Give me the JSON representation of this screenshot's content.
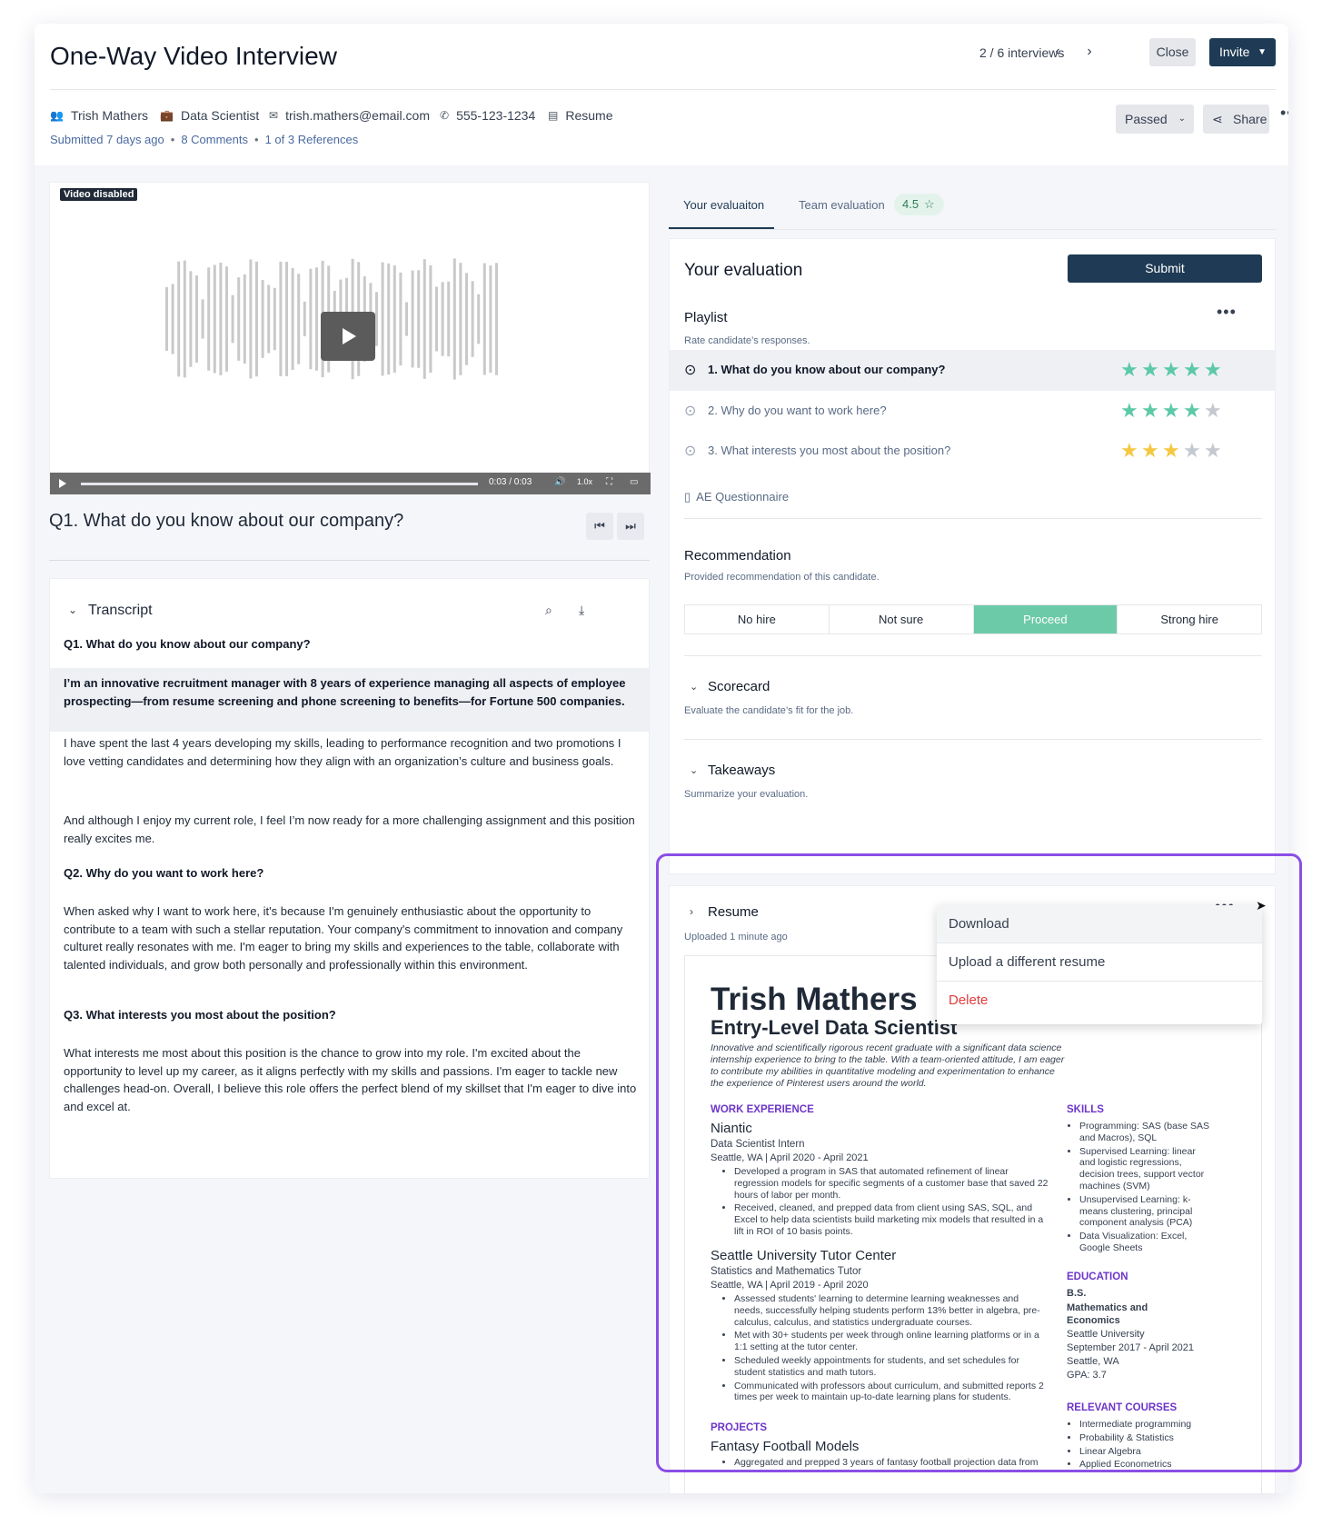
{
  "header": {
    "title": "One-Way Video Interview",
    "nav_count": "2 / 6  interviews",
    "close_label": "Close",
    "invite_label": "Invite"
  },
  "candidate": {
    "name": "Trish Mathers",
    "role": "Data Scientist",
    "email": "trish.mathers@email.com",
    "phone": "555-123-1234",
    "resume_link": "Resume",
    "submitted": "Submitted 7 days ago",
    "comments": "8 Comments",
    "references": "1 of 3 References",
    "status_label": "Passed",
    "share_label": "Share"
  },
  "video": {
    "badge": "Video disabled",
    "time": "0:03 / 0:03",
    "speed": "1.0x"
  },
  "question": {
    "title": "Q1. What do you know about our company?"
  },
  "transcript": {
    "heading": "Transcript",
    "q1": "Q1. What do you know about our company?",
    "q1_highlight": "I’m an innovative recruitment manager with 8 years of experience managing all aspects of employee prospecting—from resume screening and phone screening to benefits—for Fortune 500 companies.",
    "q1_p2": "I have spent the last 4 years developing my skills, leading to performance recognition and two promotions I love vetting candidates and determining how they align with an organization’s culture and business goals.",
    "q1_p3": "And although I enjoy my current role, I feel I’m now ready for a more challenging assignment and this position really excites me.",
    "q2": "Q2. Why do you want to work here?",
    "q2_p": "When asked why I want to work here, it's because I'm genuinely enthusiastic about the opportunity to contribute to a team with such a stellar reputation. Your company's commitment to innovation and company culturet really resonates with me. I'm eager to bring my skills and experiences to the table, collaborate with talented individuals, and grow both personally and professionally within this environment.",
    "q3": "Q3. What interests you most about the position?",
    "q3_p": "What interests me most about this position is the chance to grow into my role. I'm excited about the opportunity to level up my career, as it aligns perfectly with my skills and passions. I'm eager to tackle new challenges head-on. Overall, I believe this role offers the perfect blend of my skillset that I'm eager to dive into and excel at."
  },
  "tabs": {
    "your": "Your evaluaiton",
    "team": "Team evaluation",
    "team_score": "4.5"
  },
  "evaluation": {
    "title": "Your evaluation",
    "submit_label": "Submit",
    "playlist_heading": "Playlist",
    "playlist_desc": "Rate candidate’s responses.",
    "items": [
      {
        "label": "1. What do you know about our company?",
        "rating": 5
      },
      {
        "label": "2. Why do you want to work here?",
        "rating": 4
      },
      {
        "label": "3. What interests you most about the position?",
        "rating": 3
      }
    ],
    "ae_label": "AE Questionnaire",
    "recommendation_heading": "Recommendation",
    "recommendation_desc": "Provided recommendation of this candidate.",
    "recommendation_options": [
      "No hire",
      "Not sure",
      "Proceed",
      "Strong hire"
    ],
    "recommendation_selected": "Proceed",
    "scorecard_heading": "Scorecard",
    "scorecard_desc": "Evaluate the candidate’s fit for the job.",
    "takeaways_heading": "Takeaways",
    "takeaways_desc": "Summarize your evaluation."
  },
  "resume": {
    "heading": "Resume",
    "uploaded": "Uploaded 1 minute ago",
    "menu": [
      "Download",
      "Upload a different resume",
      "Delete"
    ],
    "doc": {
      "name": "Trish Mathers",
      "role": "Entry-Level Data Scientist",
      "summary": "Innovative and scientifically rigorous recent graduate with a significant data science internship experience to bring to the table. With a team-oriented attitude, I am eager to contribute my abilities in quantitative modeling and experimentation to enhance the experience of Pinterest users around the world.",
      "work_heading": "WORK EXPERIENCE",
      "job1_company": "Niantic",
      "job1_title": "Data Scientist Intern",
      "job1_meta": "Seattle, WA  |  April 2020 - April 2021",
      "job1_b1": "Developed a program in SAS that automated refinement of linear regression models for specific segments of a customer base that saved 22 hours of labor per month.",
      "job1_b2": "Received, cleaned, and prepped data from client using SAS, SQL, and Excel to help data scientists build marketing mix models that resulted in a lift in ROI of 10 basis points.",
      "job2_company": "Seattle University Tutor Center",
      "job2_title": "Statistics and Mathematics Tutor",
      "job2_meta": "Seattle, WA  |  April 2019 - April 2020",
      "job2_b1": "Assessed students' learning to determine learning weaknesses and needs, successfully helping students perform 13% better in algebra, pre-calculus, calculus, and statistics undergraduate courses.",
      "job2_b2": "Met with 30+ students per week through online learning platforms or in a 1:1 setting at the tutor center.",
      "job2_b3": "Scheduled weekly appointments for students, and set schedules for student statistics and math tutors.",
      "job2_b4": "Communicated with professors about curriculum, and submitted reports 2 times per week to maintain up-to-date learning plans for students.",
      "projects_heading": "PROJECTS",
      "project1": "Fantasy Football Models",
      "project1_b1": "Aggregated and prepped 3 years of fantasy football projection data from",
      "skills_heading": "SKILLS",
      "skills": [
        "Programming: SAS (base SAS and Macros), SQL",
        "Supervised Learning: linear and logistic regressions, decision trees, support vector machines (SVM)",
        "Unsupervised Learning: k-means clustering, principal component analysis (PCA)",
        "Data Visualization: Excel, Google Sheets"
      ],
      "education_heading": "EDUCATION",
      "edu_degree": "B.S.",
      "edu_major": "Mathematics and Economics",
      "edu_school": "Seattle University",
      "edu_dates": "September 2017 - April 2021",
      "edu_loc": "Seattle, WA",
      "edu_gpa": "GPA: 3.7",
      "courses_heading": "RELEVANT COURSES",
      "courses": [
        "Intermediate programming",
        "Probability & Statistics",
        "Linear Algebra",
        "Applied Econometrics"
      ]
    }
  },
  "colors": {
    "primary": "#1e3a54",
    "accent_green": "#6dcaa8",
    "star_yellow": "#f5c842",
    "highlight_purple": "#8b4ee6",
    "delete_red": "#e23b3b"
  }
}
